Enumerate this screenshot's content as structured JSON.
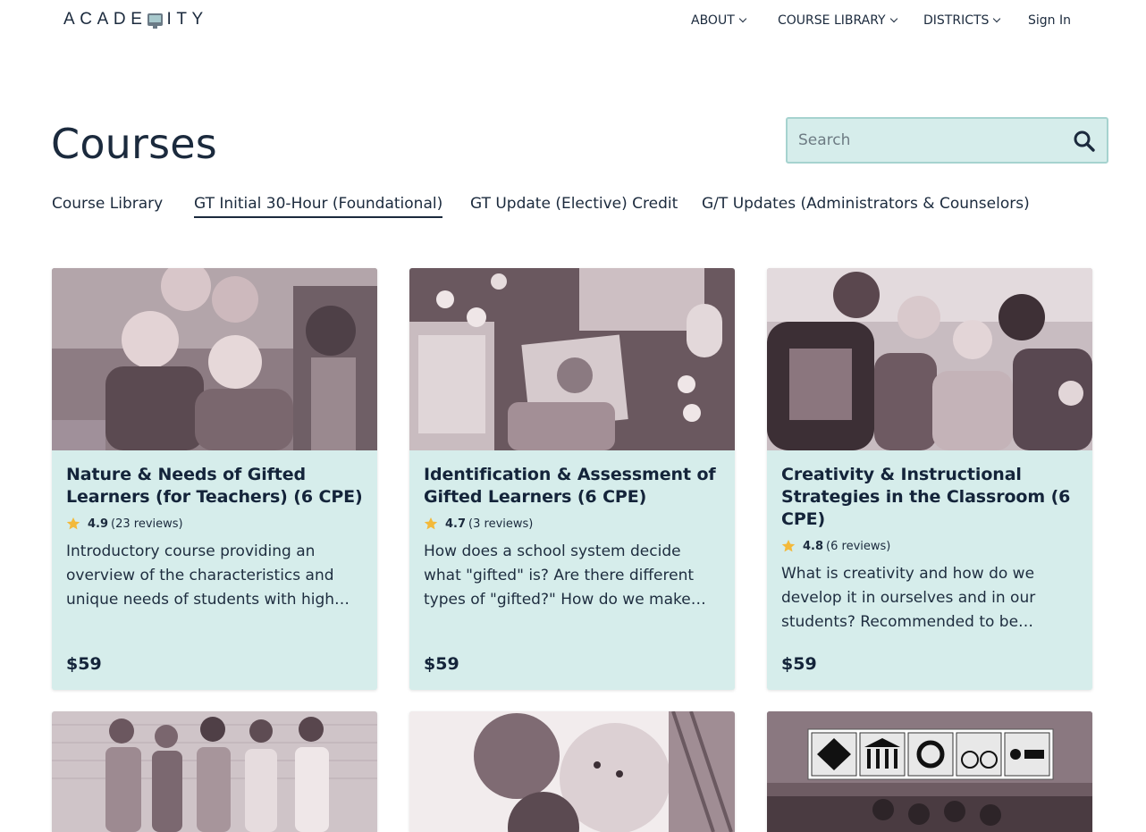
{
  "brand": {
    "logo_left": "ACADE",
    "logo_right": "ITY"
  },
  "nav": [
    {
      "label": "ABOUT",
      "has_dropdown": true
    },
    {
      "label": "COURSE LIBRARY",
      "has_dropdown": true
    },
    {
      "label": "DISTRICTS",
      "has_dropdown": true
    },
    {
      "label": "Sign In",
      "has_dropdown": false
    }
  ],
  "page": {
    "title": "Courses"
  },
  "search": {
    "placeholder": "Search",
    "value": ""
  },
  "tabs": [
    {
      "label": "Course Library",
      "active": false
    },
    {
      "label": "GT Initial 30-Hour (Foundational)",
      "active": true
    },
    {
      "label": "GT Update (Elective) Credit",
      "active": false
    },
    {
      "label": "G/T Updates (Administrators & Counselors)",
      "active": false
    }
  ],
  "courses": [
    {
      "title": "Nature & Needs of Gifted Learners (for Teachers) (6 CPE)",
      "rating": "4.9",
      "reviews": "(23 reviews)",
      "description": "Introductory course providing an overview of the characteristics and unique needs of students with high…",
      "price": "$59"
    },
    {
      "title": "Identification & Assessment of Gifted Learners (6 CPE)",
      "rating": "4.7",
      "reviews": "(3 reviews)",
      "description": "How does a school system decide what \"gifted\" is? Are there different types of \"gifted?\" How do we make sure we ar…",
      "price": "$59"
    },
    {
      "title": "Creativity & Instructional Strategies in the Classroom (6 CPE)",
      "rating": "4.8",
      "reviews": "(6 reviews)",
      "description": "What is creativity and how do we develop it in ourselves and in our students? Recommended to be…",
      "price": "$59"
    }
  ],
  "colors": {
    "card_bg": "#d6edeb",
    "text_dark": "#1b2a3d",
    "star": "#f3b93a",
    "search_border": "#a6d3cf"
  },
  "icons": {
    "search": "search-icon",
    "star": "star-icon",
    "chevron": "chevron-down-icon"
  }
}
